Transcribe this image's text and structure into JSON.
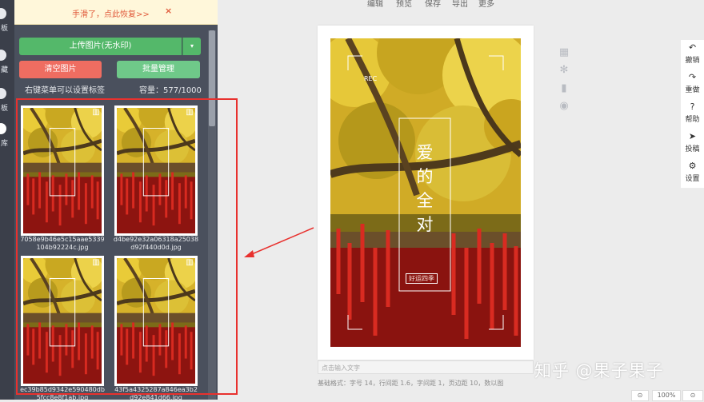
{
  "top_menu": [
    "编辑",
    "预览",
    "保存",
    "导出",
    "更多"
  ],
  "left_nav": {
    "items": [
      {
        "label": "板",
        "active": false
      },
      {
        "label": "藏",
        "active": false
      },
      {
        "label": "板",
        "active": false
      },
      {
        "label": "库",
        "active": true
      }
    ]
  },
  "toast": {
    "text": "手滑了，点此恢复>>",
    "close": "×"
  },
  "panel": {
    "upload_label": "上传图片(无水印)",
    "upload_caret": "▾",
    "clear_label": "清空图片",
    "batch_label": "批量管理",
    "hint": "右键菜单可以设置标签",
    "capacity": "容量：577/1000"
  },
  "images": [
    {
      "name": "7058e9b46e5c15aae5339104b92224c.jpg"
    },
    {
      "name": "d4be92e32a06318a25038d92f440d0d.jpg"
    },
    {
      "name": "ec39b85d9342e590480db5fcc8e8f1ab.jpg"
    },
    {
      "name": "43f5a4325287a846ea3b2d92e841d66.jpg"
    }
  ],
  "poster": {
    "rec": "REC",
    "title_chars": [
      "爱",
      "的",
      "全",
      "对"
    ],
    "tag": "好运四季"
  },
  "editor": {
    "input_placeholder": "点击输入文字",
    "format_text": "基础格式：字号 14，行间距 1.6，字间距 1，页边距 10，数以图"
  },
  "right_toolbar": [
    {
      "icon": "undo-icon",
      "label": "撤销"
    },
    {
      "icon": "redo-icon",
      "label": "重做"
    },
    {
      "icon": "help-icon",
      "label": "帮助"
    },
    {
      "icon": "send-icon",
      "label": "投稿"
    },
    {
      "icon": "gear-icon",
      "label": "设置"
    }
  ],
  "mid_tools": [
    "grid-icon",
    "gear-icon",
    "bar-chart-icon",
    "eye-icon"
  ],
  "watermark": "知乎 @果子果子",
  "bottom_controls": [
    "⊙",
    "100%",
    "⊙"
  ],
  "colors": {
    "panel": "#4a505d",
    "green": "#54b86a",
    "red": "#ef6d61",
    "annotation_red": "#e8312e"
  }
}
